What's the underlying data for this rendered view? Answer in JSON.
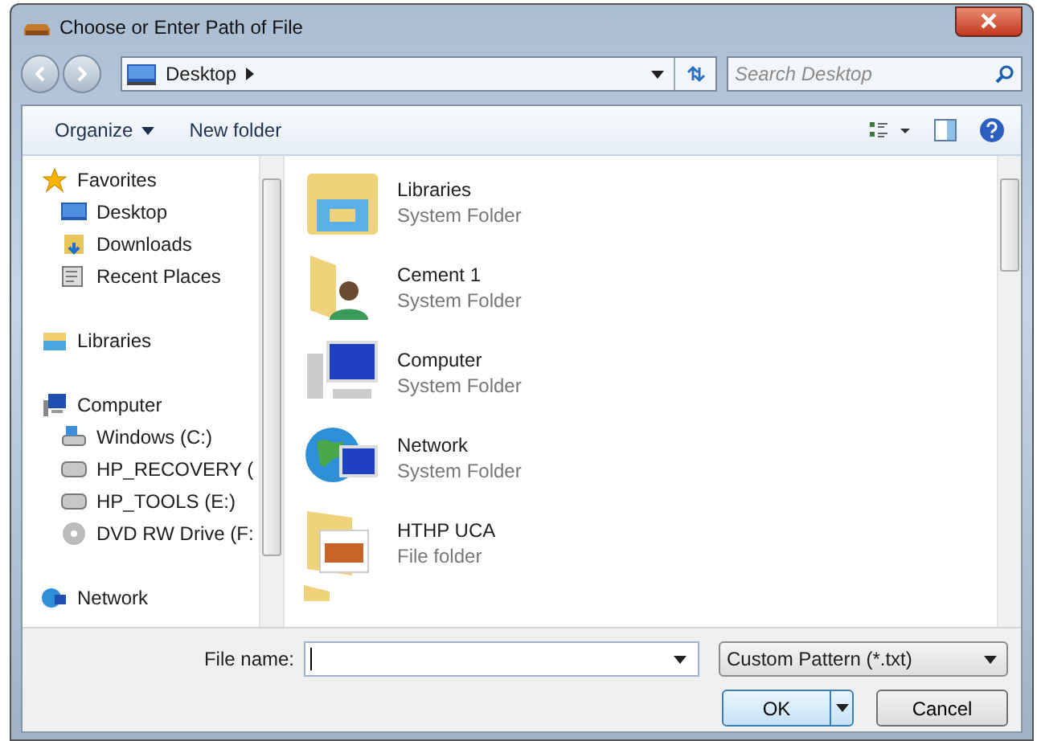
{
  "window": {
    "title": "Choose or Enter Path of File"
  },
  "address_bar": {
    "path": "Desktop"
  },
  "search": {
    "placeholder": "Search Desktop"
  },
  "toolbar": {
    "organize": "Organize",
    "new_folder": "New folder"
  },
  "navigation": [
    {
      "label": "Favorites",
      "children": [
        {
          "label": "Desktop"
        },
        {
          "label": "Downloads"
        },
        {
          "label": "Recent Places"
        }
      ]
    },
    {
      "label": "Libraries"
    },
    {
      "label": "Computer",
      "children": [
        {
          "label": "Windows (C:)"
        },
        {
          "label": "HP_RECOVERY ("
        },
        {
          "label": "HP_TOOLS (E:)"
        },
        {
          "label": "DVD RW Drive (F:"
        }
      ]
    },
    {
      "label": "Network"
    }
  ],
  "items": [
    {
      "name": "Libraries",
      "type": "System Folder"
    },
    {
      "name": "Cement 1",
      "type": "System Folder"
    },
    {
      "name": "Computer",
      "type": "System Folder"
    },
    {
      "name": "Network",
      "type": "System Folder"
    },
    {
      "name": "HTHP UCA",
      "type": "File folder"
    }
  ],
  "file_name": {
    "label": "File name:"
  },
  "file_type": {
    "value": "Custom Pattern (*.txt)"
  },
  "buttons": {
    "ok": "OK",
    "cancel": "Cancel"
  }
}
